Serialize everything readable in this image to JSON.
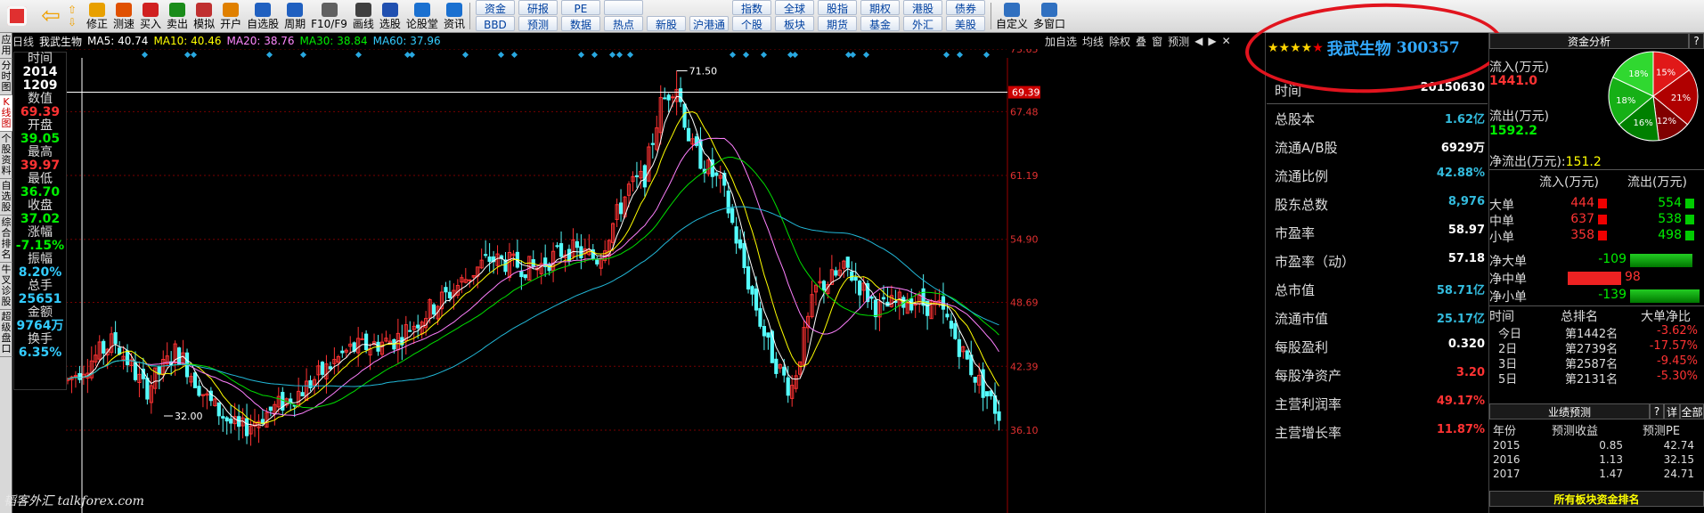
{
  "toolbar": {
    "left": [
      {
        "icon": "quote-icon",
        "label": "修正"
      },
      {
        "icon": "clock-icon",
        "label": "测速"
      },
      {
        "icon": "buy-icon",
        "label": "买入"
      },
      {
        "icon": "sell-icon",
        "label": "卖出"
      },
      {
        "icon": "sim-icon",
        "label": "模拟"
      },
      {
        "icon": "open-icon",
        "label": "开户"
      },
      {
        "icon": "watch-icon",
        "label": "自选股"
      },
      {
        "icon": "period-icon",
        "label": "周期"
      },
      {
        "icon": "f10-icon",
        "label": "F10/F9"
      },
      {
        "icon": "draw-icon",
        "label": "画线"
      },
      {
        "icon": "select-icon",
        "label": "选股"
      },
      {
        "icon": "forum-icon",
        "label": "论股堂"
      },
      {
        "icon": "news-icon",
        "label": "资讯"
      }
    ],
    "grid_top": [
      "资金",
      "研报",
      "PE",
      "",
      "指数",
      "全球",
      "股指",
      "期权",
      "港股",
      "债券"
    ],
    "grid_bottom": [
      "BBD",
      "预测",
      "数据",
      "热点",
      "新股",
      "沪港通",
      "个股",
      "板块",
      "期货",
      "基金",
      "外汇",
      "美股"
    ],
    "right": [
      {
        "icon": "custom-icon",
        "label": "自定义"
      },
      {
        "icon": "multiwin-icon",
        "label": "多窗口"
      }
    ]
  },
  "vtabs": [
    "应用",
    "分时图",
    "K线图",
    "个股资料",
    "自选股",
    "综合排名",
    "牛叉诊股",
    "超级盘口"
  ],
  "ma": {
    "period": "日线",
    "name": "我武生物",
    "ma5": "MA5: 40.74",
    "ma10": "MA10: 40.46",
    "ma20": "MA20: 38.76",
    "ma30": "MA30: 38.84",
    "ma60": "MA60: 37.96"
  },
  "chart_tools": [
    "加自选",
    "均线",
    "除权",
    "叠",
    "窗",
    "预测"
  ],
  "databox": {
    "time_label": "时间",
    "date1": "2014",
    "date2": "1209",
    "value_label": "数值",
    "value": "69.39",
    "open_label": "开盘",
    "open": "39.05",
    "high_label": "最高",
    "high": "39.97",
    "low_label": "最低",
    "low": "36.70",
    "close_label": "收盘",
    "close": "37.02",
    "chg_label": "涨幅",
    "chg": "-7.15%",
    "amp_label": "振幅",
    "amp": "8.20%",
    "hand_label": "总手",
    "hand": "25651",
    "amt_label": "金额",
    "amt": "9764万",
    "turn_label": "换手",
    "turn": "6.35%"
  },
  "chart_data": {
    "type": "candlestick",
    "price_labels": [
      "73.65",
      "69.39",
      "67.48",
      "61.19",
      "54.90",
      "48.69",
      "42.39",
      "36.10"
    ],
    "high_mark": "71.50",
    "low_mark": "32.00",
    "colors": {
      "up": "#ff3232",
      "down": "#54fcfc",
      "ma5": "#ffffff",
      "ma10": "#ffff00",
      "ma20": "#ff80ff",
      "ma30": "#00e000",
      "ma60": "#22b8d8"
    }
  },
  "info": {
    "stars": "★★★★★",
    "name": "我武生物",
    "code": "300357",
    "rows": [
      {
        "label": "时间",
        "value": "20150630",
        "cls": "w"
      },
      {
        "label": "总股本",
        "value": "1.62亿",
        "cls": "c"
      },
      {
        "label": "流通A/B股",
        "value": "6929万",
        "cls": "w"
      },
      {
        "label": "流通比例",
        "value": "42.88%",
        "cls": "c"
      },
      {
        "label": "股东总数",
        "value": "8,976",
        "cls": "c"
      },
      {
        "label": "市盈率",
        "value": "58.97",
        "cls": "w"
      },
      {
        "label": "市盈率（动）",
        "value": "57.18",
        "cls": "w"
      },
      {
        "label": "总市值",
        "value": "58.71亿",
        "cls": "c"
      },
      {
        "label": "流通市值",
        "value": "25.17亿",
        "cls": "c"
      },
      {
        "label": "每股盈利",
        "value": "0.320",
        "cls": "w"
      },
      {
        "label": "每股净资产",
        "value": "3.20",
        "cls": "r"
      },
      {
        "label": "主营利润率",
        "value": "49.17%",
        "cls": "r"
      },
      {
        "label": "主营增长率",
        "value": "11.87%",
        "cls": "r"
      }
    ]
  },
  "flow": {
    "title": "资金分析",
    "help": "?",
    "in_label": "流入(万元)",
    "in_val": "1441.0",
    "out_label": "流出(万元)",
    "out_val": "1592.2",
    "net_label": "净流出(万元):",
    "net_val": "151.2",
    "pie": [
      {
        "label": "15%",
        "color": "#e01818"
      },
      {
        "label": "21%",
        "color": "#b00000"
      },
      {
        "label": "12%",
        "color": "#800000"
      },
      {
        "label": "16%",
        "color": "#008000"
      },
      {
        "label": "18%",
        "color": "#16b016"
      },
      {
        "label": "18%",
        "color": "#30d830"
      }
    ],
    "table_head": [
      "流入(万元)",
      "流出(万元)"
    ],
    "orders": [
      {
        "label": "大单",
        "in": "444",
        "out": "554"
      },
      {
        "label": "中单",
        "in": "637",
        "out": "538"
      },
      {
        "label": "小单",
        "in": "358",
        "out": "498"
      }
    ],
    "net": [
      {
        "label": "净大单",
        "value": "-109"
      },
      {
        "label": "净中单",
        "value": "98"
      },
      {
        "label": "净小单",
        "value": "-139"
      }
    ],
    "rank_head": [
      "时间",
      "总排名",
      "大单净比"
    ],
    "ranks": [
      {
        "t": "今日",
        "r": "第1442名",
        "p": "-3.62%"
      },
      {
        "t": "2日",
        "r": "第2739名",
        "p": "-17.57%"
      },
      {
        "t": "3日",
        "r": "第2587名",
        "p": "-9.45%"
      },
      {
        "t": "5日",
        "r": "第2131名",
        "p": "-5.30%"
      }
    ],
    "forecast_title": "业绩预测",
    "forecast_tabs": [
      "?",
      "详",
      "全部"
    ],
    "forecast_head": [
      "年份",
      "预测收益",
      "预测PE"
    ],
    "forecast": [
      {
        "y": "2015",
        "e": "0.85",
        "pe": "42.74"
      },
      {
        "y": "2016",
        "e": "1.13",
        "pe": "32.15"
      },
      {
        "y": "2017",
        "e": "1.47",
        "pe": "24.71"
      }
    ],
    "sector_title": "所有板块资金排名"
  },
  "watermark": "韬客外汇 talkforex.com"
}
